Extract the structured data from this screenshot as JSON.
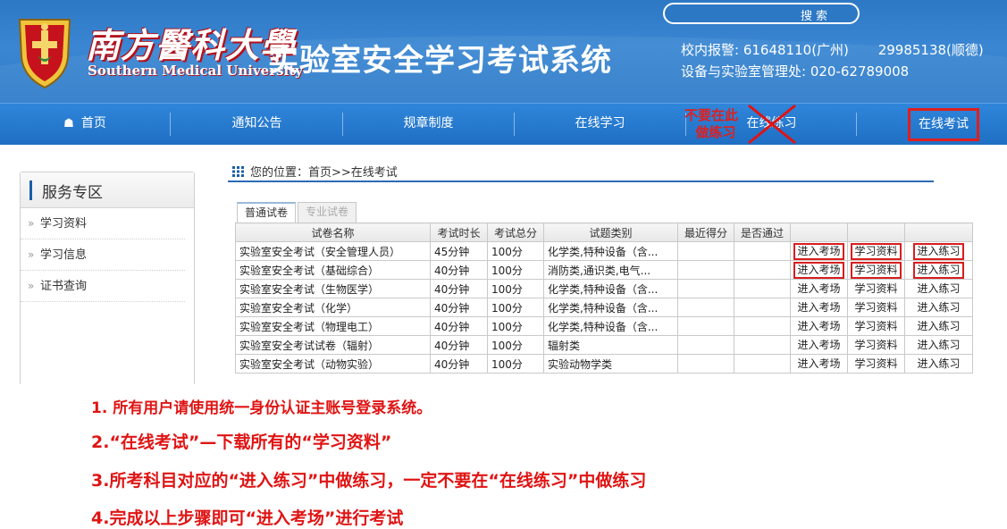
{
  "header": {
    "university_cn": "南方醫科大學",
    "university_en": "Southern Medical University",
    "system_title": "实验室安全学习考试系统",
    "search_label": "搜索",
    "contact_line1_label": "校内报警:",
    "contact_line1_num1": "61648110(广州)",
    "contact_line1_num2": "29985138(顺德)",
    "contact_line2": "设备与实验室管理处: 020-62789008"
  },
  "nav": {
    "items": [
      {
        "label": "首页",
        "icon": "home-icon"
      },
      {
        "label": "通知公告"
      },
      {
        "label": "规章制度"
      },
      {
        "label": "在线学习"
      },
      {
        "label": "在线练习"
      },
      {
        "label": "在线考试"
      }
    ],
    "note_line1": "不要在此",
    "note_line2": "做练习"
  },
  "sidebar": {
    "title": "服务专区",
    "items": [
      {
        "label": "学习资料"
      },
      {
        "label": "学习信息"
      },
      {
        "label": "证书查询"
      }
    ]
  },
  "breadcrumb": "您的位置：首页>>在线考试",
  "tabs": [
    {
      "label": "普通试卷",
      "active": true
    },
    {
      "label": "专业试卷",
      "active": false
    }
  ],
  "table": {
    "headers": [
      "试卷名称",
      "考试时长",
      "考试总分",
      "试题类别",
      "最近得分",
      "是否通过",
      "",
      "",
      ""
    ],
    "rows": [
      {
        "name": "实验室安全考试（安全管理人员）",
        "duration": "45分钟",
        "total": "100分",
        "category": "化学类,特种设备（含...",
        "score": "",
        "passed": "",
        "enter": "进入考场",
        "study": "学习资料",
        "practice": "进入练习",
        "highlight": true
      },
      {
        "name": "实验室安全考试（基础综合）",
        "duration": "40分钟",
        "total": "100分",
        "category": "消防类,通识类,电气...",
        "score": "",
        "passed": "",
        "enter": "进入考场",
        "study": "学习资料",
        "practice": "进入练习",
        "highlight": true
      },
      {
        "name": "实验室安全考试（生物医学）",
        "duration": "40分钟",
        "total": "100分",
        "category": "化学类,特种设备（含...",
        "score": "",
        "passed": "",
        "enter": "进入考场",
        "study": "学习资料",
        "practice": "进入练习",
        "highlight": false
      },
      {
        "name": "实验室安全考试（化学）",
        "duration": "40分钟",
        "total": "100分",
        "category": "化学类,特种设备（含...",
        "score": "",
        "passed": "",
        "enter": "进入考场",
        "study": "学习资料",
        "practice": "进入练习",
        "highlight": false
      },
      {
        "name": "实验室安全考试（物理电工）",
        "duration": "40分钟",
        "total": "100分",
        "category": "化学类,特种设备（含...",
        "score": "",
        "passed": "",
        "enter": "进入考场",
        "study": "学习资料",
        "practice": "进入练习",
        "highlight": false
      },
      {
        "name": "实验室安全考试试卷（辐射）",
        "duration": "40分钟",
        "total": "100分",
        "category": "辐射类",
        "score": "",
        "passed": "",
        "enter": "进入考场",
        "study": "学习资料",
        "practice": "进入练习",
        "highlight": false
      },
      {
        "name": "实验室安全考试（动物实验）",
        "duration": "40分钟",
        "total": "100分",
        "category": "实验动物学类",
        "score": "",
        "passed": "",
        "enter": "进入考场",
        "study": "学习资料",
        "practice": "进入练习",
        "highlight": false
      }
    ]
  },
  "instructions": [
    "1. 所有用户请使用统一身份认证主账号登录系统。",
    "2.“在线考试”—下载所有的“学习资料”",
    "3.所考科目对应的“进入练习”中做练习，一定不要在“在线练习”中做练习",
    "4.完成以上步骤即可“进入考场”进行考试"
  ],
  "colors": {
    "header_blue": "#2d78c4",
    "nav_blue": "#1f6fc4",
    "annotation_red": "#e01414"
  }
}
